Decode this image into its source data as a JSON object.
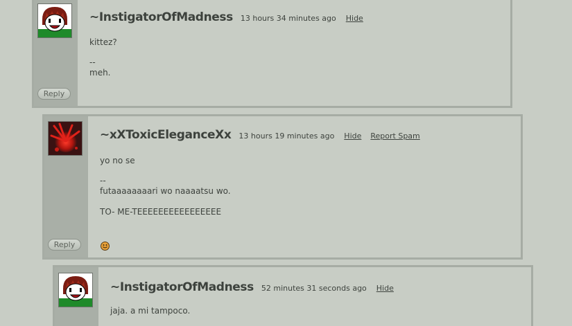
{
  "comments": [
    {
      "username": "~InstigatorOfMadness",
      "timestamp": "13 hours 34 minutes ago",
      "links": [
        "Hide"
      ],
      "message": "kittez?",
      "signature_sep": "--",
      "signature": "meh.",
      "reply_label": "Reply",
      "avatar_icon": "cartoon-boy-avatar-icon"
    },
    {
      "username": "~xXToxicEleganceXx",
      "timestamp": "13 hours 19 minutes ago",
      "links": [
        "Hide",
        "Report Spam"
      ],
      "message": "yo no se",
      "signature_sep": "--",
      "signature": "futaaaaaaaari wo naaaatsu wo.",
      "signature2": "TO- ME-TEEEEEEEEEEEEEEEE",
      "reply_label": "Reply",
      "avatar_icon": "red-splatter-avatar-icon",
      "emoticon": "smiley-icon"
    },
    {
      "username": "~InstigatorOfMadness",
      "timestamp": "52 minutes 31 seconds ago",
      "links": [
        "Hide"
      ],
      "message": "jaja. a mi tampoco.",
      "avatar_icon": "cartoon-boy-avatar-icon"
    }
  ],
  "colors": {
    "background": "#c8cdc5",
    "rail": "#a9afa7",
    "border": "#a6aca4",
    "text": "#3d423d"
  }
}
